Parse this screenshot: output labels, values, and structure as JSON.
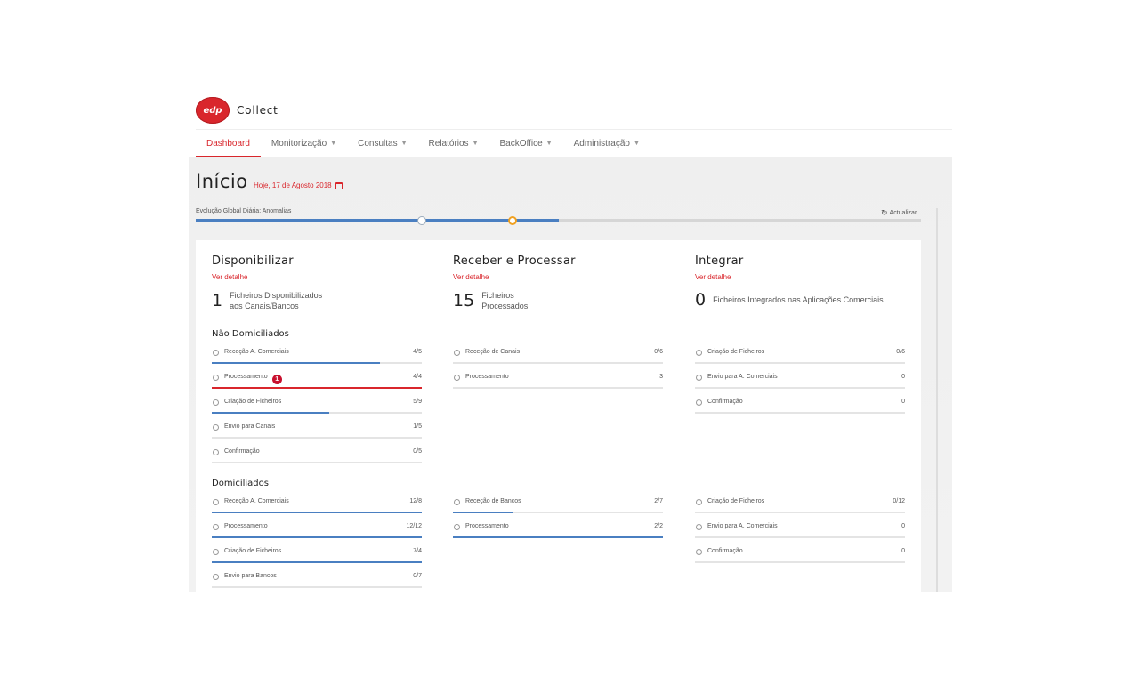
{
  "app": {
    "logo_text": "edp",
    "name": "Collect"
  },
  "nav": [
    {
      "label": "Dashboard"
    },
    {
      "label": "Monitorização"
    },
    {
      "label": "Consultas"
    },
    {
      "label": "Relatórios"
    },
    {
      "label": "BackOffice"
    },
    {
      "label": "Administração"
    }
  ],
  "page": {
    "title": "Início",
    "date": "Hoje, 17 de Agosto 2018"
  },
  "evolution": {
    "label": "Evolução Global Diária: Anomalias",
    "refresh_label": "Actualizar",
    "progress": 0.5
  },
  "columns": [
    {
      "title": "Disponibilizar",
      "detail_link": "Ver detalhe",
      "count": "1",
      "count_label": "Ficheiros Disponibilizados\naos Canais/Bancos",
      "nao_domiciliados": {
        "title": "Não Domiciliados",
        "rows": [
          {
            "label": "Receção A. Comerciais",
            "value": "4/5",
            "progress": 0.8
          },
          {
            "label": "Processamento",
            "value": "4/4",
            "progress": 1.0,
            "badge": "1",
            "status": "error"
          },
          {
            "label": "Criação de Ficheiros",
            "value": "5/9",
            "progress": 0.56
          },
          {
            "label": "Envio para Canais",
            "value": "1/5",
            "progress": 0
          },
          {
            "label": "Confirmação",
            "value": "0/5",
            "progress": 0
          }
        ]
      },
      "domiciliados": {
        "title": "Domiciliados",
        "rows": [
          {
            "label": "Receção A. Comerciais",
            "value": "12/8",
            "progress": 1.0
          },
          {
            "label": "Processamento",
            "value": "12/12",
            "progress": 1.0
          },
          {
            "label": "Criação de Ficheiros",
            "value": "7/4",
            "progress": 1.0
          },
          {
            "label": "Envio para Bancos",
            "value": "0/7",
            "progress": 0
          }
        ]
      }
    },
    {
      "title": "Receber e Processar",
      "detail_link": "Ver detalhe",
      "count": "15",
      "count_label": "Ficheiros\nProcessados",
      "nao_domiciliados": {
        "rows": [
          {
            "label": "Receção de Canais",
            "value": "0/6",
            "progress": 0
          },
          {
            "label": "Processamento",
            "value": "3",
            "progress": 0
          }
        ]
      },
      "domiciliados": {
        "rows": [
          {
            "label": "Receção de Bancos",
            "value": "2/7",
            "progress": 0.29
          },
          {
            "label": "Processamento",
            "value": "2/2",
            "progress": 1.0
          }
        ]
      }
    },
    {
      "title": "Integrar",
      "detail_link": "Ver detalhe",
      "count": "0",
      "count_label": "Ficheiros Integrados nas Aplicações Comerciais",
      "nao_domiciliados": {
        "rows": [
          {
            "label": "Criação de Ficheiros",
            "value": "0/6",
            "progress": 0
          },
          {
            "label": "Envio para A. Comerciais",
            "value": "0",
            "progress": 0
          },
          {
            "label": "Confirmação",
            "value": "0",
            "progress": 0
          }
        ]
      },
      "domiciliados": {
        "rows": [
          {
            "label": "Criação de Ficheiros",
            "value": "0/12",
            "progress": 0
          },
          {
            "label": "Envio para A. Comerciais",
            "value": "0",
            "progress": 0
          },
          {
            "label": "Confirmação",
            "value": "0",
            "progress": 0
          }
        ]
      }
    }
  ],
  "colors": {
    "accent": "#d9262c",
    "progress": "#4a7fc1",
    "track": "#e4e4e4"
  }
}
